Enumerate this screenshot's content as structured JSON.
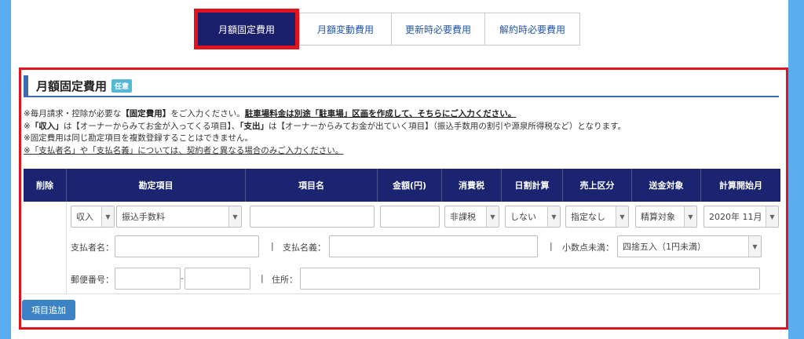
{
  "tabs": [
    {
      "label": "月額固定費用"
    },
    {
      "label": "月額変動費用"
    },
    {
      "label": "更新時必要費用"
    },
    {
      "label": "解約時必要費用"
    }
  ],
  "section": {
    "title": "月額固定費用",
    "badge": "任意"
  },
  "notes": {
    "line1_a": "※毎月請求・控除が必要な",
    "line1_b": "【固定費用】",
    "line1_c": "をご入力ください。",
    "line1_d": "駐車場料金は別途「駐車場」区画を作成して、そちらにご入力ください。",
    "line2_a": "※",
    "line2_b": "「収入」",
    "line2_c": "は【オーナーからみてお金が入ってくる項目】、",
    "line2_d": "「支出」",
    "line2_e": "は【オーナーからみてお金が出ていく項目】（振込手数用の割引や源泉所得税など）となります。",
    "line3": "※固定費用は同じ勘定項目を複数登録することはできません。",
    "line4": "※「支払者名」や「支払名義」については、契約者と異なる場合のみご入力ください。"
  },
  "table": {
    "headers": [
      "削除",
      "勘定項目",
      "項目名",
      "金額(円)",
      "消費税",
      "日割計算",
      "売上区分",
      "送金対象",
      "計算開始月"
    ],
    "row": {
      "income_type": "収入",
      "account_item": "振込手数料",
      "item_name": "",
      "amount": "",
      "tax": "非課税",
      "proration": "しない",
      "sales_category": "指定なし",
      "remit_target": "精算対象",
      "start_month": "2020年 11月"
    },
    "payer_label": "支払者名：",
    "payer_value": "",
    "sep1": "|",
    "account_name_label": "支払名義：",
    "account_name_value": "",
    "sep2": "|",
    "decimal_label": "小数点未満：",
    "decimal_value": "四捨五入（1円未満）",
    "postal_label": "郵便番号：",
    "postal_dash": "-",
    "sep3": "|",
    "address_label": "住所："
  },
  "add_button": "項目追加"
}
